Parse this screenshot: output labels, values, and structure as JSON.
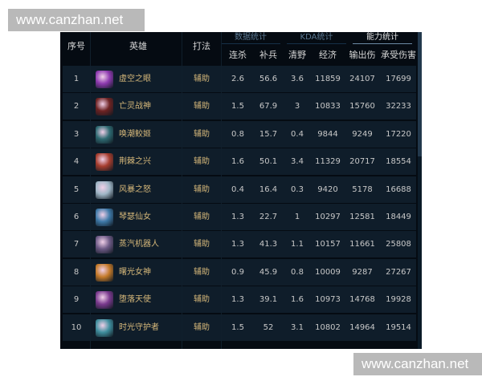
{
  "watermarks": {
    "top": "www.canzhan.net",
    "bottom": "www.canzhan.net"
  },
  "tabs": [
    {
      "label": "数据统计",
      "active": false
    },
    {
      "label": "KDA统计",
      "active": false
    },
    {
      "label": "能力统计",
      "active": true
    }
  ],
  "columns": {
    "index": "序号",
    "hero": "英雄",
    "role": "打法",
    "kills": "连杀",
    "cs": "补兵",
    "jungle": "清野",
    "gold": "经济",
    "damage_dealt": "输出伤害",
    "damage_taken": "承受伤害"
  },
  "colors": {
    "panel_bg": "#050b12",
    "row_bg": "#0f1d2a",
    "hero_text": "#d6b87a",
    "value_text": "#c8c8c8"
  },
  "rows": [
    {
      "index": "1",
      "hero": "虚空之眼",
      "avatar_icon": "velkoz-portrait-icon",
      "avatar_color": "#8e3ab0",
      "role": "辅助",
      "kills": "2.6",
      "cs": "56.6",
      "jungle": "3.6",
      "gold": "11859",
      "damage_dealt": "24107",
      "damage_taken": "17699"
    },
    {
      "index": "2",
      "hero": "亡灵战神",
      "avatar_icon": "sion-portrait-icon",
      "avatar_color": "#6e2323",
      "role": "辅助",
      "kills": "1.5",
      "cs": "67.9",
      "jungle": "3",
      "gold": "10833",
      "damage_dealt": "15760",
      "damage_taken": "32233"
    },
    {
      "index": "3",
      "hero": "唤潮鲛姬",
      "avatar_icon": "nami-portrait-icon",
      "avatar_color": "#2e6a72",
      "role": "辅助",
      "kills": "0.8",
      "cs": "15.7",
      "jungle": "0.4",
      "gold": "9844",
      "damage_dealt": "9249",
      "damage_taken": "17220"
    },
    {
      "index": "4",
      "hero": "荆棘之兴",
      "avatar_icon": "zyra-portrait-icon",
      "avatar_color": "#a63d2e",
      "role": "辅助",
      "kills": "1.6",
      "cs": "50.1",
      "jungle": "3.4",
      "gold": "11329",
      "damage_dealt": "20717",
      "damage_taken": "18554"
    },
    {
      "index": "5",
      "hero": "风暴之怒",
      "avatar_icon": "janna-portrait-icon",
      "avatar_color": "#9fb6c6",
      "role": "辅助",
      "kills": "0.4",
      "cs": "16.4",
      "jungle": "0.3",
      "gold": "9420",
      "damage_dealt": "5178",
      "damage_taken": "16688"
    },
    {
      "index": "6",
      "hero": "琴瑟仙女",
      "avatar_icon": "sona-portrait-icon",
      "avatar_color": "#3e79a8",
      "role": "辅助",
      "kills": "1.3",
      "cs": "22.7",
      "jungle": "1",
      "gold": "10297",
      "damage_dealt": "12581",
      "damage_taken": "18449"
    },
    {
      "index": "7",
      "hero": "蒸汽机器人",
      "avatar_icon": "blitzcrank-portrait-icon",
      "avatar_color": "#6d5a86",
      "role": "辅助",
      "kills": "1.3",
      "cs": "41.3",
      "jungle": "1.1",
      "gold": "10157",
      "damage_dealt": "11661",
      "damage_taken": "25808"
    },
    {
      "index": "8",
      "hero": "曙光女神",
      "avatar_icon": "leona-portrait-icon",
      "avatar_color": "#c47a2a",
      "role": "辅助",
      "kills": "0.9",
      "cs": "45.9",
      "jungle": "0.8",
      "gold": "10009",
      "damage_dealt": "9287",
      "damage_taken": "27267"
    },
    {
      "index": "9",
      "hero": "堕落天使",
      "avatar_icon": "morgana-portrait-icon",
      "avatar_color": "#7a3a8e",
      "role": "辅助",
      "kills": "1.3",
      "cs": "39.1",
      "jungle": "1.6",
      "gold": "10973",
      "damage_dealt": "14768",
      "damage_taken": "19928"
    },
    {
      "index": "10",
      "hero": "时光守护者",
      "avatar_icon": "zilean-portrait-icon",
      "avatar_color": "#3f8e9e",
      "role": "辅助",
      "kills": "1.5",
      "cs": "52",
      "jungle": "3.1",
      "gold": "10802",
      "damage_dealt": "14964",
      "damage_taken": "19514"
    }
  ]
}
